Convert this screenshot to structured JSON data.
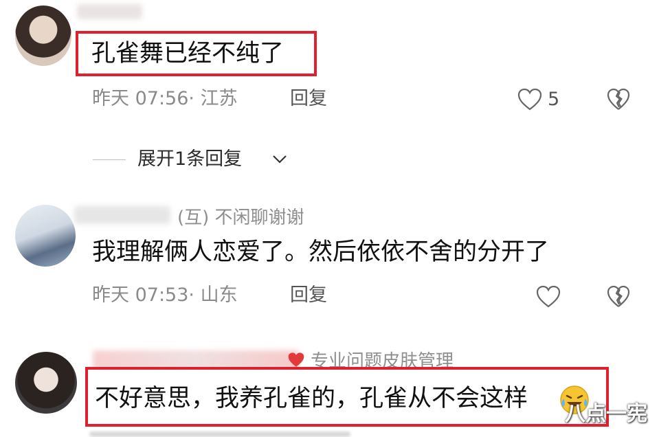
{
  "comments": [
    {
      "text": "孔雀舞已经不纯了",
      "time": "昨天 07:56",
      "location": "江苏",
      "reply_label": "回复",
      "likes": "5"
    },
    {
      "tag": "(互) 不闲聊谢谢",
      "text": "我理解俩人恋爱了。然后依依不舍的分开了",
      "time": "昨天 07:53",
      "location": "山东",
      "reply_label": "回复"
    },
    {
      "tag": "专业问题皮肤管理",
      "text": "不好意思，我养孔雀的，孔雀从不会这样"
    }
  ],
  "expand_replies": "展开1条回复",
  "watermark": "八点一宪",
  "colors": {
    "highlight": "#e0202c",
    "meta": "#8a8a8a"
  },
  "icons": [
    "heart-outline-icon",
    "broken-heart-icon",
    "chevron-down-icon",
    "laugh-cry-emoji-icon"
  ]
}
